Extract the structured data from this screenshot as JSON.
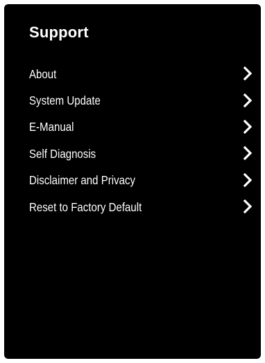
{
  "screen": {
    "title": "Support"
  },
  "menu": {
    "items": [
      {
        "label": "About",
        "icon": "chevron-right-icon"
      },
      {
        "label": "System Update",
        "icon": "chevron-right-icon"
      },
      {
        "label": "E-Manual",
        "icon": "chevron-right-icon"
      },
      {
        "label": "Self Diagnosis",
        "icon": "chevron-right-icon"
      },
      {
        "label": "Disclaimer and Privacy",
        "icon": "chevron-right-icon"
      },
      {
        "label": "Reset to Factory Default",
        "icon": "chevron-right-icon"
      }
    ]
  },
  "colors": {
    "background": "#000000",
    "text": "#ffffff",
    "page": "#ffffff"
  }
}
